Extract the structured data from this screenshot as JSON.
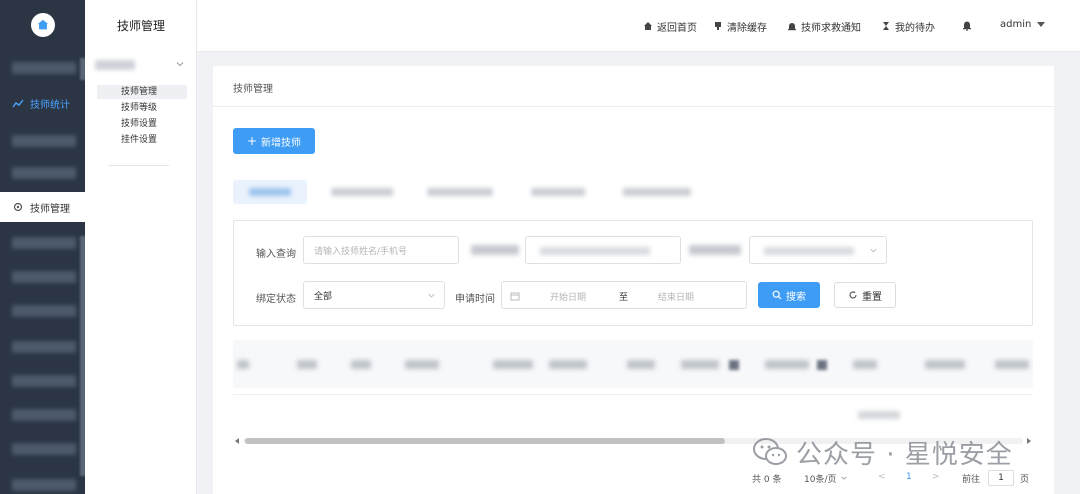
{
  "header": {
    "home_link": "返回首页",
    "clear_cache": "清除缓存",
    "notice": "技师求救通知",
    "mine": "我的待办",
    "user": "admin"
  },
  "rail": {
    "stats_label": "技师统计",
    "manage_label": "技师管理"
  },
  "side": {
    "title": "技师管理",
    "links": [
      "技师管理",
      "技师等级",
      "技师设置",
      "挂件设置"
    ]
  },
  "content": {
    "breadcrumb": "技师管理",
    "add_button": "新增技师"
  },
  "filter": {
    "query_label": "输入查询",
    "query_placeholder": "请输入技师姓名/手机号",
    "bind_label": "绑定状态",
    "bind_value": "全部",
    "apply_label": "申请时间",
    "start_placeholder": "开始日期",
    "to_label": "至",
    "end_placeholder": "结束日期",
    "search_button": "搜索",
    "reset_button": "重置"
  },
  "pager": {
    "total": "共 0 条",
    "page_size": "10条/页",
    "prev": "<",
    "current": "1",
    "next": ">",
    "goto_label": "前往",
    "goto_value": "1",
    "page_suffix": "页"
  },
  "watermark": {
    "text": "公众号 · 星悦安全"
  },
  "colors": {
    "primary": "#3f9cf4",
    "rail_bg": "#2b3544",
    "rail_active_text": "#4aa3ff"
  }
}
